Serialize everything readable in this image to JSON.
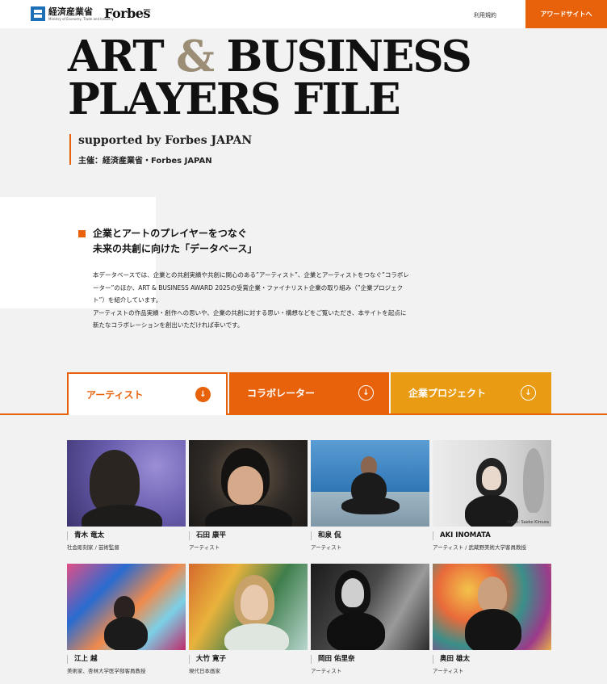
{
  "header": {
    "meti_name": "経済産業省",
    "meti_english": "Ministry of Economy, Trade and Industry",
    "forbes_logo": "Forbes",
    "forbes_logo_sub": "JAPAN",
    "terms_label": "利用規約",
    "award_button_label": "アワードサイトへ"
  },
  "hero": {
    "title_line1_a": "ART ",
    "title_amp": "&",
    "title_line1_b": " BUSINESS",
    "title_line2": "PLAYERS FILE",
    "supported_by": "supported by Forbes JAPAN",
    "organizer": "主催：経済産業省・Forbes JAPAN"
  },
  "intro": {
    "heading_line1": "企業とアートのプレイヤーをつなぐ",
    "heading_line2": "未来の共創に向けた「データベース」",
    "body_p1": "本データベースでは、企業との共創実績や共創に関心のある”アーティスト”、企業とアーティストをつなぐ”コラボレーター”のほか、ART & BUSINESS AWARD 2025の受賞企業・ファイナリスト企業の取り組み（”企業プロジェクト”）を紹介しています。",
    "body_p2": "アーティストの作品実績・創作への思いや、企業の共創に対する思い・構想などをご覧いただき、本サイトを起点に新たなコラボレーションを創出いただければ幸いです。"
  },
  "tabs": [
    {
      "label": "アーティスト",
      "active": true
    },
    {
      "label": "コラボレーター",
      "active": false
    },
    {
      "label": "企業プロジェクト",
      "active": false
    }
  ],
  "tab_arrow_glyph": "↓",
  "colors": {
    "accent_orange": "#e8620b",
    "accent_yellow": "#e99c13",
    "background": "#f2f2f2"
  },
  "artists": [
    {
      "name": "青木 竜太",
      "role": "社会彫刻家 / 芸術監督"
    },
    {
      "name": "石田 康平",
      "role": "アーティスト"
    },
    {
      "name": "和泉 侃",
      "role": "アーティスト"
    },
    {
      "name": "AKI INOMATA",
      "role": "アーティスト / 武蔵野美術大学客員教授",
      "photo_credit": "Photo: Saeko Kimura"
    },
    {
      "name": "江上 越",
      "role": "美術家、杏林大学医学部客員教授"
    },
    {
      "name": "大竹 寛子",
      "role": "現代日本画家"
    },
    {
      "name": "岡田 佑里奈",
      "role": "アーティスト"
    },
    {
      "name": "奥田 雄太",
      "role": "アーティスト"
    }
  ]
}
